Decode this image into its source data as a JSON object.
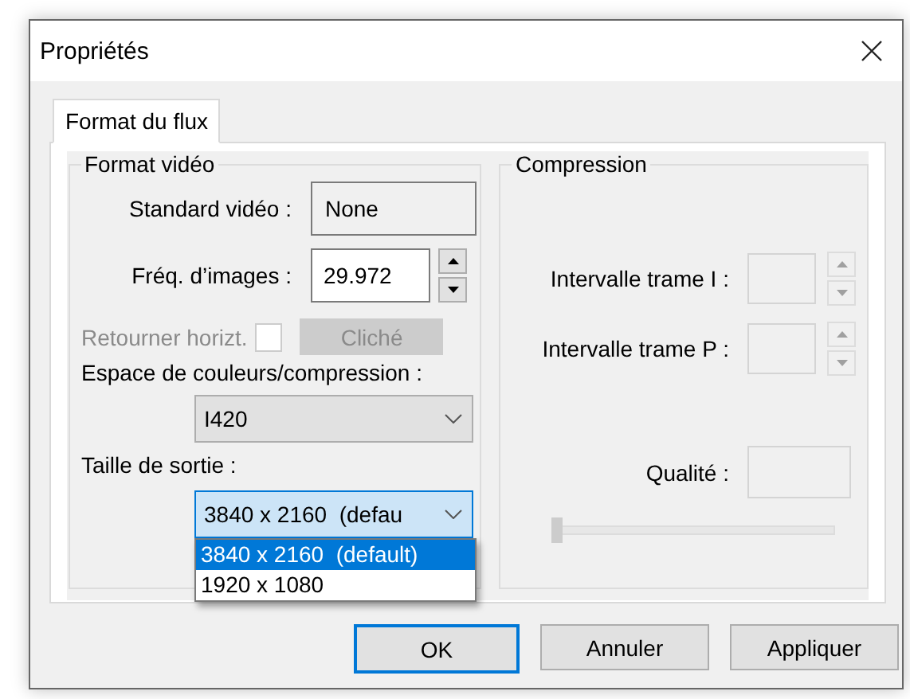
{
  "window": {
    "title": "Propriétés"
  },
  "tabs": [
    {
      "label": "Format du flux",
      "selected": true
    }
  ],
  "video_format": {
    "title": "Format vidéo",
    "fields": [
      {
        "kind": "readonly",
        "label": "Standard vidéo :",
        "value": "None"
      },
      {
        "kind": "spin",
        "label": "Fréq. d’images :",
        "value": "29.972"
      }
    ],
    "flip": {
      "label": "Retourner horizt.",
      "checked": false,
      "disabled": true
    },
    "snapshot_button": {
      "label": "Cliché",
      "disabled": true
    },
    "colorspace": {
      "label": "Espace de couleurs/compression :",
      "value": "I420"
    },
    "output_size": {
      "label": "Taille de sortie :",
      "value": "3840 x 2160  (defau",
      "expanded": true,
      "options": [
        {
          "label": "3840 x 2160  (default)",
          "selected": true
        },
        {
          "label": "1920 x 1080",
          "selected": false
        }
      ]
    }
  },
  "compression": {
    "title": "Compression",
    "fields": [
      {
        "kind": "spin",
        "label": "Intervalle trame I :",
        "disabled": true
      },
      {
        "kind": "spin",
        "label": "Intervalle trame P :",
        "disabled": true
      },
      {
        "kind": "box",
        "label": "Qualité :",
        "disabled": true
      }
    ],
    "quality_slider": {
      "level": 0,
      "disabled": true
    }
  },
  "buttons": [
    {
      "label": "OK",
      "default": true
    },
    {
      "label": "Annuler",
      "default": false
    },
    {
      "label": "Appliquer",
      "default": false
    }
  ]
}
